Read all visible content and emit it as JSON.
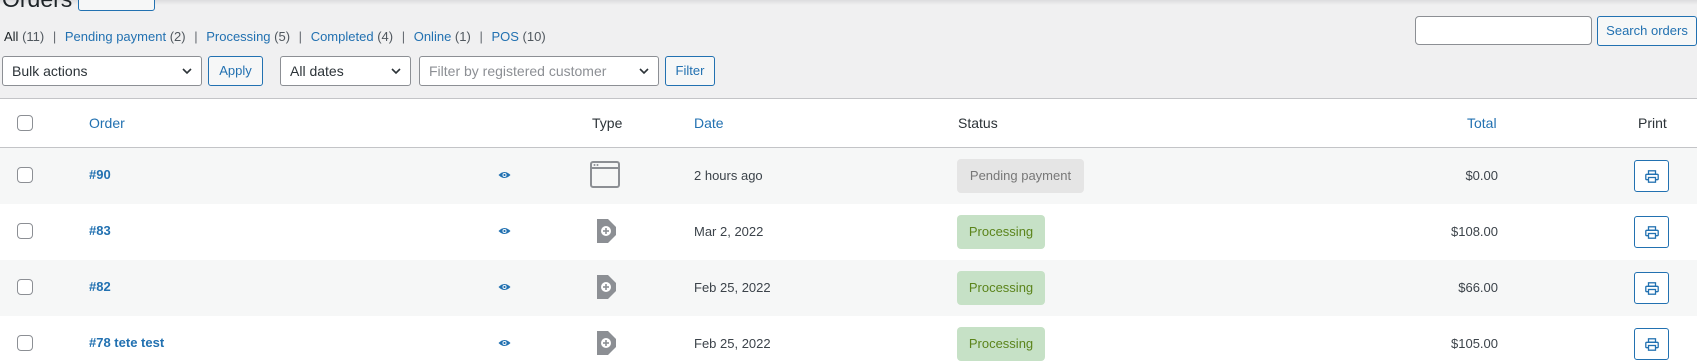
{
  "page": {
    "title": "Orders",
    "add_new_label": ""
  },
  "views": [
    {
      "label": "All",
      "count": "(11)",
      "current": true
    },
    {
      "label": "Pending payment",
      "count": "(2)"
    },
    {
      "label": "Processing",
      "count": "(5)"
    },
    {
      "label": "Completed",
      "count": "(4)"
    },
    {
      "label": "Online",
      "count": "(1)"
    },
    {
      "label": "POS",
      "count": "(10)"
    }
  ],
  "search": {
    "placeholder": "",
    "button_label": "Search orders"
  },
  "toolbar": {
    "bulk_actions": "Bulk actions",
    "apply_label": "Apply",
    "dates": "All dates",
    "customer_placeholder": "Filter by registered customer",
    "filter_label": "Filter"
  },
  "columns": {
    "order": "Order",
    "type": "Type",
    "date": "Date",
    "status": "Status",
    "total": "Total",
    "print": "Print"
  },
  "rows": [
    {
      "order": "#90",
      "type": "online",
      "date": "2 hours ago",
      "status": "Pending payment",
      "status_kind": "pending",
      "total": "$0.00"
    },
    {
      "order": "#83",
      "type": "pos",
      "date": "Mar 2, 2022",
      "status": "Processing",
      "status_kind": "processing",
      "total": "$108.00"
    },
    {
      "order": "#82",
      "type": "pos",
      "date": "Feb 25, 2022",
      "status": "Processing",
      "status_kind": "processing",
      "total": "$66.00"
    },
    {
      "order": "#78 tete test",
      "type": "pos",
      "date": "Feb 25, 2022",
      "status": "Processing",
      "status_kind": "processing",
      "total": "$105.00"
    }
  ],
  "icons": {
    "view": "eye-icon",
    "online_type": "browser-window-icon",
    "pos_type": "pos-tag-icon",
    "print": "printer-icon",
    "dropdown": "chevron-down-icon"
  },
  "colors": {
    "link": "#2271b1",
    "processing_bg": "#c6e1c6",
    "processing_text": "#5b841b",
    "pending_bg": "#e5e5e5",
    "pending_text": "#777777"
  }
}
